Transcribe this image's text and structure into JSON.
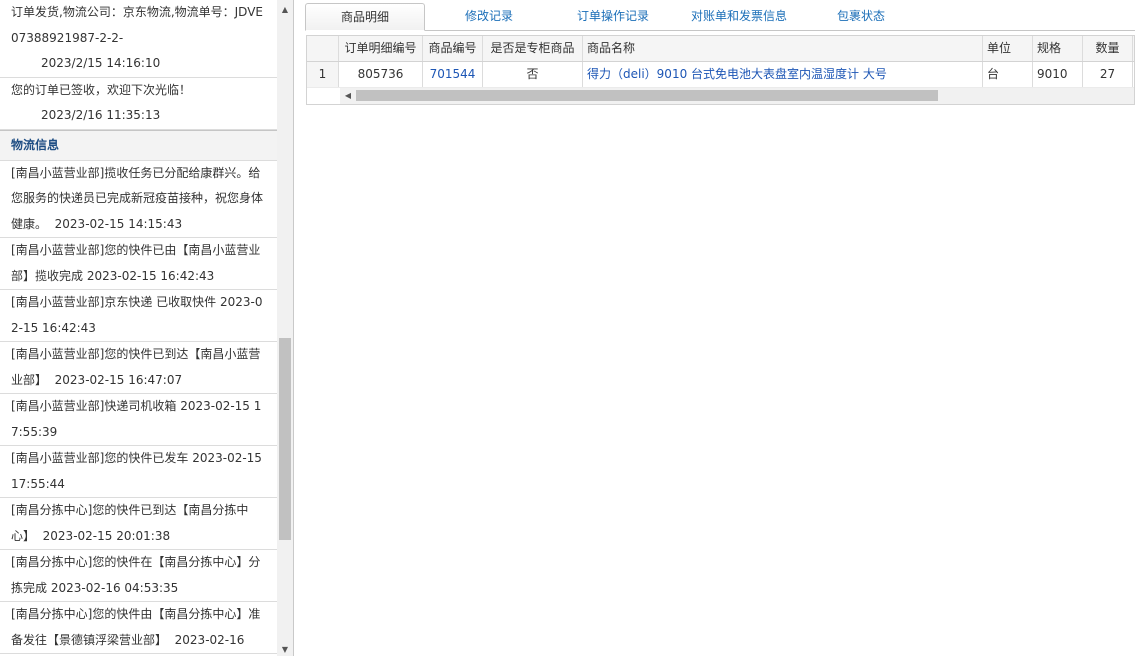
{
  "left": {
    "top_entries": [
      {
        "text": "订单发货,物流公司：京东物流,物流单号：JDVE07388921987-2-2-",
        "ts": "2023/2/15 14:16:10"
      },
      {
        "text": "您的订单已签收，欢迎下次光临！",
        "ts": "2023/2/16 11:35:13"
      }
    ],
    "logistics_header": "物流信息",
    "logistics_entries": [
      {
        "text": "[南昌小蓝营业部]揽收任务已分配给康群兴。给您服务的快递员已完成新冠疫苗接种，祝您身体健康。",
        "ts": "2023-02-15 14:15:43"
      },
      {
        "text": "[南昌小蓝营业部]您的快件已由【南昌小蓝营业部】揽收完成",
        "ts": "2023-02-15 16:42:43"
      },
      {
        "text": "[南昌小蓝营业部]京东快递 已收取快件",
        "ts": "2023-02-15 16:42:43"
      },
      {
        "text": "[南昌小蓝营业部]您的快件已到达【南昌小蓝营业部】",
        "ts": "2023-02-15 16:47:07"
      },
      {
        "text": "[南昌小蓝营业部]快递司机收箱",
        "ts": "2023-02-15 17:55:39"
      },
      {
        "text": "[南昌小蓝营业部]您的快件已发车",
        "ts": "2023-02-15 17:55:44"
      },
      {
        "text": "[南昌分拣中心]您的快件已到达【南昌分拣中心】",
        "ts": "2023-02-15 20:01:38"
      },
      {
        "text": "[南昌分拣中心]您的快件在【南昌分拣中心】分拣完成",
        "ts": "2023-02-16 04:53:35"
      },
      {
        "text": "[南昌分拣中心]您的快件由【南昌分拣中心】准备发往【景德镇浮梁营业部】",
        "ts": "2023-02-16"
      }
    ],
    "scroll_up_icon": "triangle-up",
    "scroll_down_icon": "triangle-down"
  },
  "tabs": [
    {
      "label": "商品明细",
      "active": true
    },
    {
      "label": "修改记录",
      "active": false
    },
    {
      "label": "订单操作记录",
      "active": false
    },
    {
      "label": "对账单和发票信息",
      "active": false
    },
    {
      "label": "包裹状态",
      "active": false
    }
  ],
  "grid": {
    "columns": [
      "订单明细编号",
      "商品编号",
      "是否是专柜商品",
      "商品名称",
      "单位",
      "规格",
      "数量"
    ],
    "rows": [
      {
        "row_number": "1",
        "detail_id": "805736",
        "product_id": "701544",
        "is_counter": "否",
        "name": "得力（deli）9010 台式免电池大表盘室内温湿度计 大号",
        "unit": "台",
        "spec": "9010",
        "qty": "27"
      }
    ],
    "link_color": "#1d56b5"
  }
}
